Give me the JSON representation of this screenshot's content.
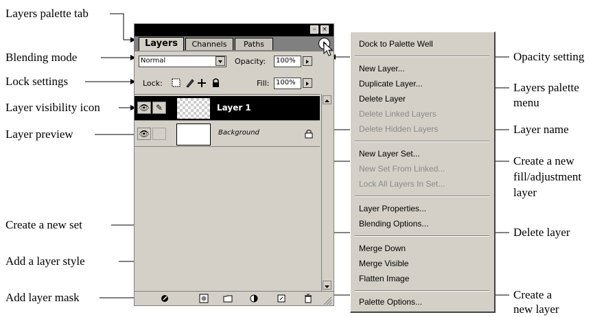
{
  "palette": {
    "tabs": [
      {
        "label": "Layers",
        "active": true
      },
      {
        "label": "Channels",
        "active": false
      },
      {
        "label": "Paths",
        "active": false
      }
    ],
    "blend_mode": "Normal",
    "opacity_label": "Opacity:",
    "opacity_value": "100%",
    "lock_label": "Lock:",
    "fill_label": "Fill:",
    "fill_value": "100%",
    "layers": [
      {
        "name": "Layer 1",
        "selected": true
      },
      {
        "name": "Background",
        "selected": false
      }
    ]
  },
  "menu": {
    "items": [
      {
        "label": "Dock to Palette Well",
        "enabled": true
      },
      {
        "label": "New Layer...",
        "enabled": true
      },
      {
        "label": "Duplicate Layer...",
        "enabled": true
      },
      {
        "label": "Delete Layer",
        "enabled": true
      },
      {
        "label": "Delete Linked Layers",
        "enabled": false
      },
      {
        "label": "Delete Hidden Layers",
        "enabled": false
      },
      {
        "label": "New Layer Set...",
        "enabled": true
      },
      {
        "label": "New Set From Linked...",
        "enabled": false
      },
      {
        "label": "Lock All Layers In Set...",
        "enabled": false
      },
      {
        "label": "Layer Properties...",
        "enabled": true
      },
      {
        "label": "Blending Options...",
        "enabled": true
      },
      {
        "label": "Merge Down",
        "enabled": true
      },
      {
        "label": "Merge Visible",
        "enabled": true
      },
      {
        "label": "Flatten Image",
        "enabled": true
      },
      {
        "label": "Palette Options...",
        "enabled": true
      }
    ]
  },
  "callouts": {
    "layers_palette_tab": "Layers palette tab",
    "blending_mode": "Blending mode",
    "lock_settings": "Lock settings",
    "layer_visibility_icon": "Layer visibility icon",
    "layer_preview": "Layer preview",
    "create_new_set": "Create a new set",
    "add_layer_style": "Add a layer style",
    "add_layer_mask": "Add layer mask",
    "opacity_setting": "Opacity setting",
    "layers_palette_menu_1": "Layers palette",
    "layers_palette_menu_2": "menu",
    "layer_name": "Layer name",
    "create_fill_1": "Create a new",
    "create_fill_2": "fill/adjustment",
    "create_fill_3": "layer",
    "delete_layer": "Delete layer",
    "create_new_layer_1": "Create a",
    "create_new_layer_2": "new layer"
  }
}
